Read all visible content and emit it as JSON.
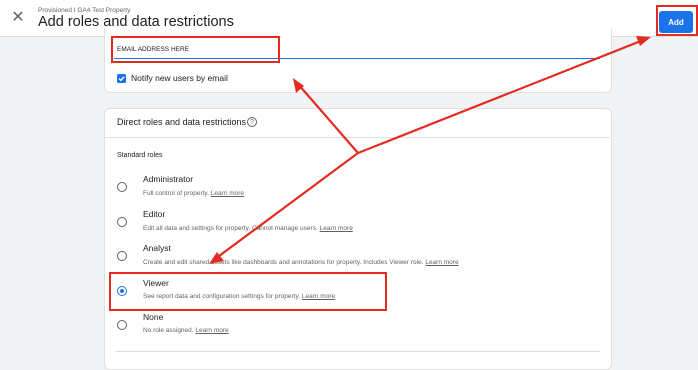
{
  "header": {
    "subtitle": "Provisioned I GA4 Test Property",
    "title": "Add roles and data restrictions",
    "close_icon": "close-icon",
    "add_label": "Add"
  },
  "email": {
    "value": "EMAIL ADDRESS HERE"
  },
  "notify": {
    "checked": true,
    "label": "Notify new users by email"
  },
  "section": {
    "title": "Direct roles and data restrictions",
    "help_icon": "help-circle-icon",
    "help_glyph": "?",
    "standard_roles_label": "Standard roles"
  },
  "roles": [
    {
      "name": "Administrator",
      "desc": "Full control of property.",
      "link": "Learn more",
      "selected": false
    },
    {
      "name": "Editor",
      "desc": "Edit all data and settings for property. Cannot manage users.",
      "link": "Learn more",
      "selected": false
    },
    {
      "name": "Analyst",
      "desc": "Create and edit shared assets like dashboards and annotations for property. Includes Viewer role.",
      "link": "Learn more",
      "selected": false
    },
    {
      "name": "Viewer",
      "desc": "See report data and configuration settings for property.",
      "link": "Learn more",
      "selected": true
    },
    {
      "name": "None",
      "desc": "No role assigned.",
      "link": "Learn more",
      "selected": false
    }
  ],
  "colors": {
    "accent": "#1a73e8",
    "annotation_red": "#e32b1f"
  }
}
